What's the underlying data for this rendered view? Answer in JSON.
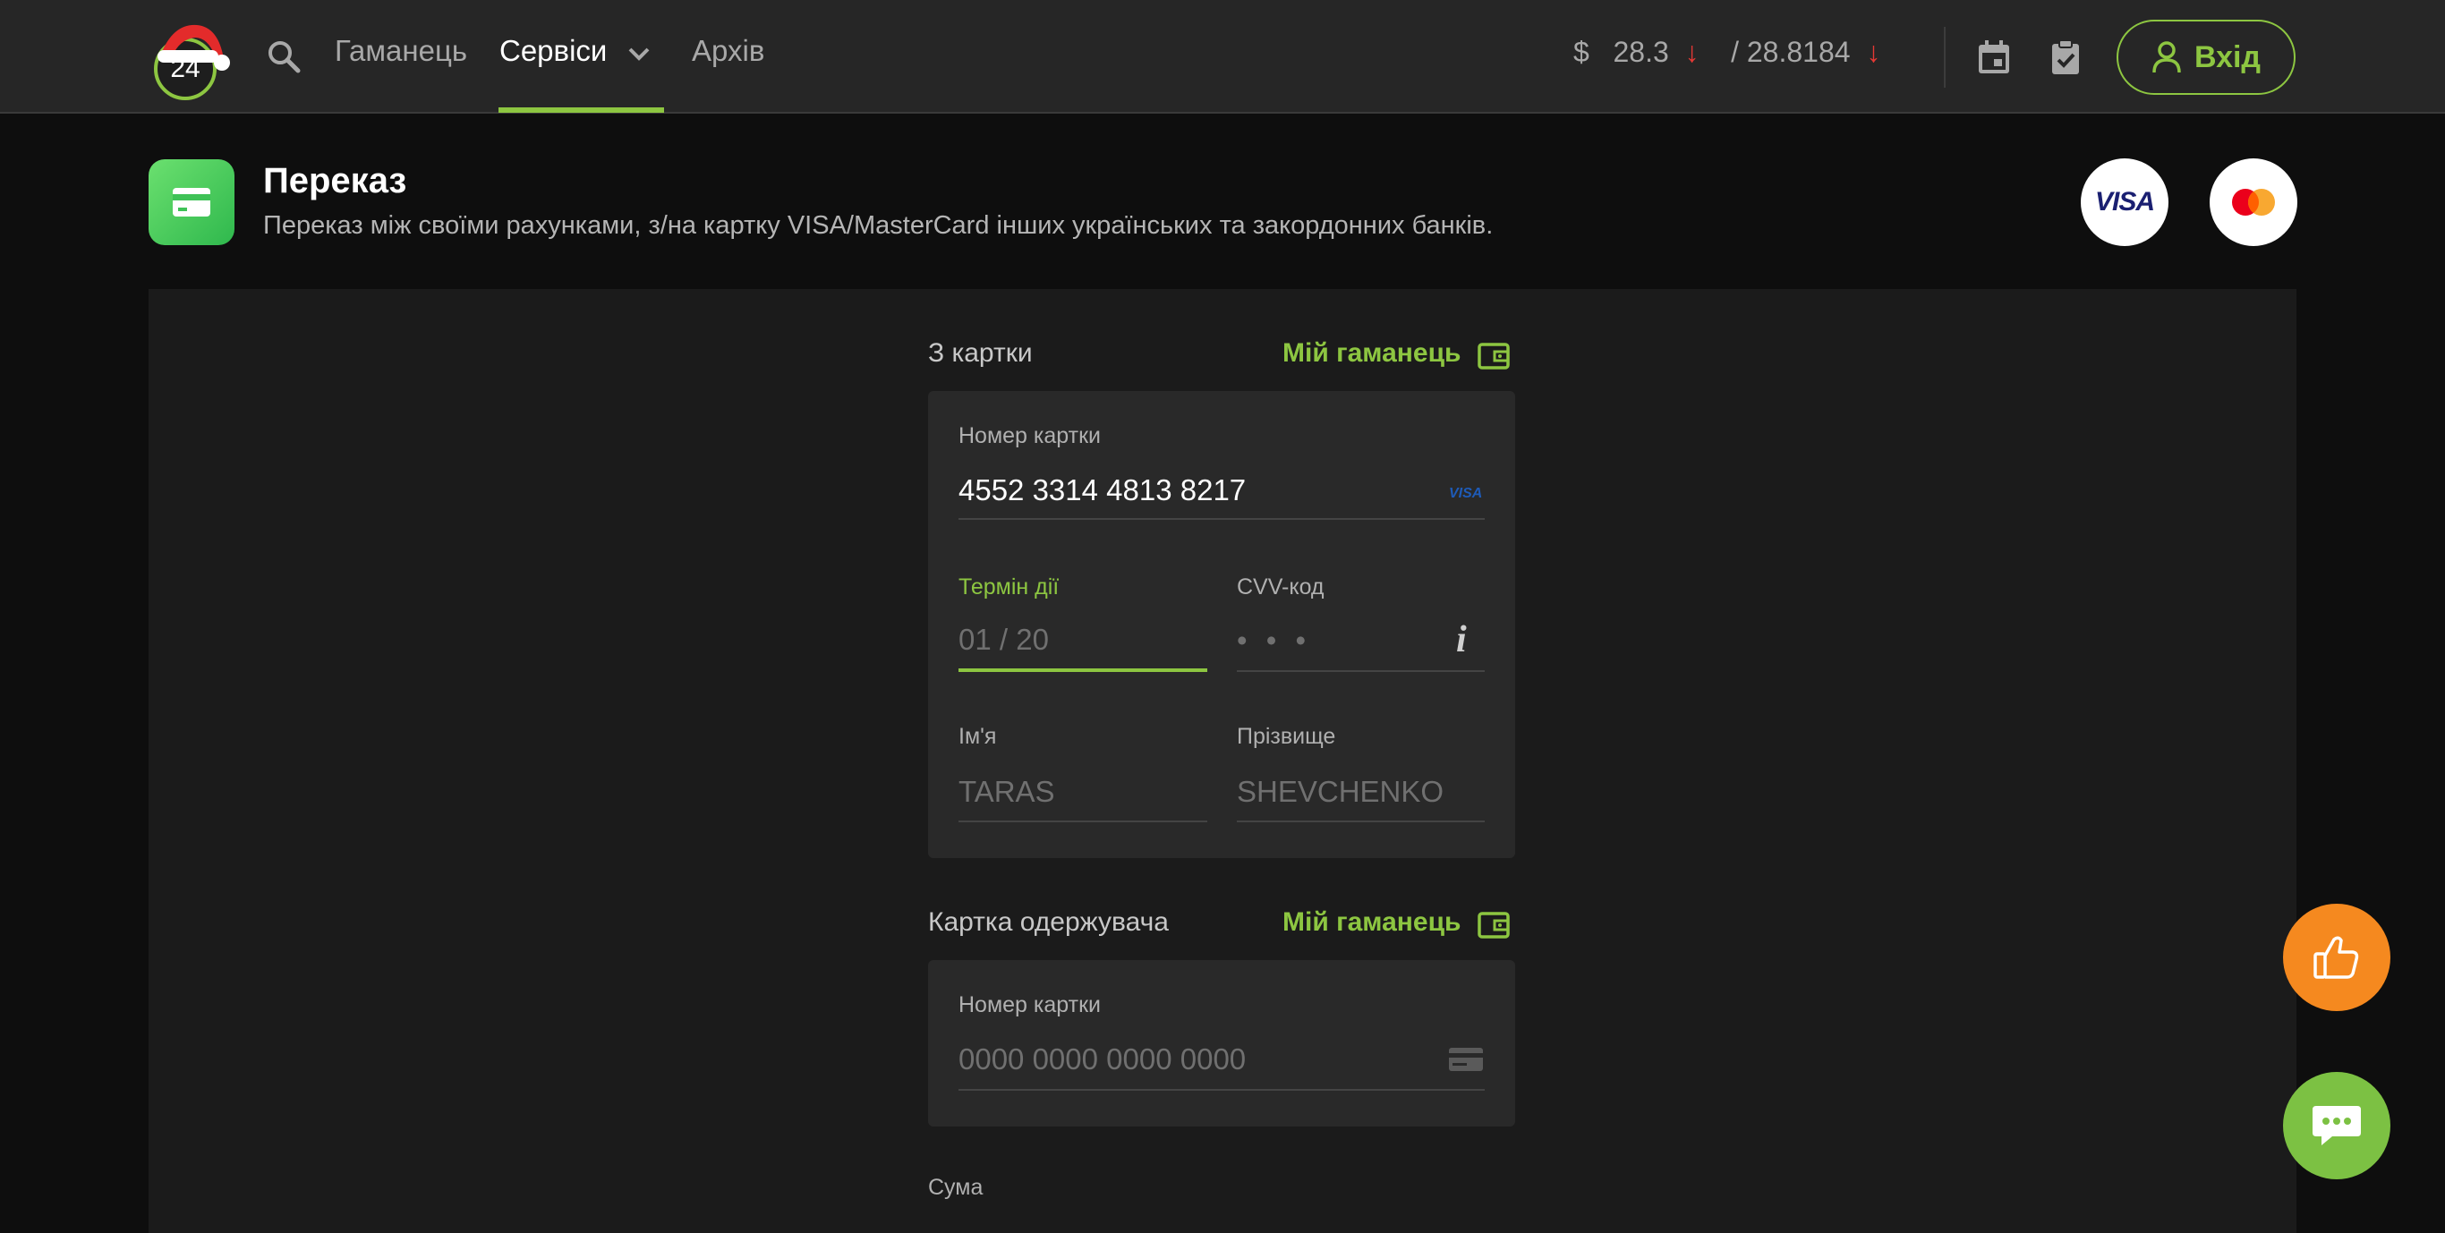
{
  "header": {
    "logo_text": "24",
    "nav": [
      {
        "label": "Гаманець"
      },
      {
        "label": "Сервіси"
      },
      {
        "label": "Архів"
      }
    ],
    "rates": {
      "currency_symbol": "$",
      "buy": "28.3",
      "sell": "/ 28.8184",
      "arrow": "↓"
    },
    "login_label": "Вхід"
  },
  "service": {
    "title": "Переказ",
    "subtitle": "Переказ між своїми рахунками, з/на картку VISA/MasterCard інших українських та закордонних банків.",
    "visa_logo": "VISA"
  },
  "from_card": {
    "section_label": "З картки",
    "wallet_link": "Мій гаманець",
    "card_number_label": "Номер картки",
    "card_number_value": "4552 3314 4813 8217",
    "card_brand": "VISA",
    "expiry_label": "Термін дії",
    "expiry_placeholder": "01 / 20",
    "cvv_label": "CVV-код",
    "cvv_placeholder": "• • •",
    "cvv_info": "i",
    "first_name_label": "Ім'я",
    "first_name_placeholder": "TARAS",
    "last_name_label": "Прізвище",
    "last_name_placeholder": "SHEVCHENKO"
  },
  "to_card": {
    "section_label": "Картка одержувача",
    "wallet_link": "Мій гаманець",
    "card_number_label": "Номер картки",
    "card_number_placeholder": "0000 0000 0000 0000"
  },
  "amount": {
    "label": "Сума"
  },
  "colors": {
    "accent": "#8dc641",
    "header_bg": "#262626",
    "panel_bg": "#1b1b1b",
    "card_bg": "#292929",
    "rate_down": "#e53935",
    "like_fab": "#f5891f",
    "chat_fab": "#7cc143"
  },
  "icons": {
    "search": "search-icon",
    "calendar": "calendar-icon",
    "clipboard": "clipboard-check-icon",
    "user": "user-icon",
    "wallet": "wallet-icon",
    "card": "credit-card-icon",
    "like": "thumbs-up-icon",
    "chat": "chat-icon"
  }
}
